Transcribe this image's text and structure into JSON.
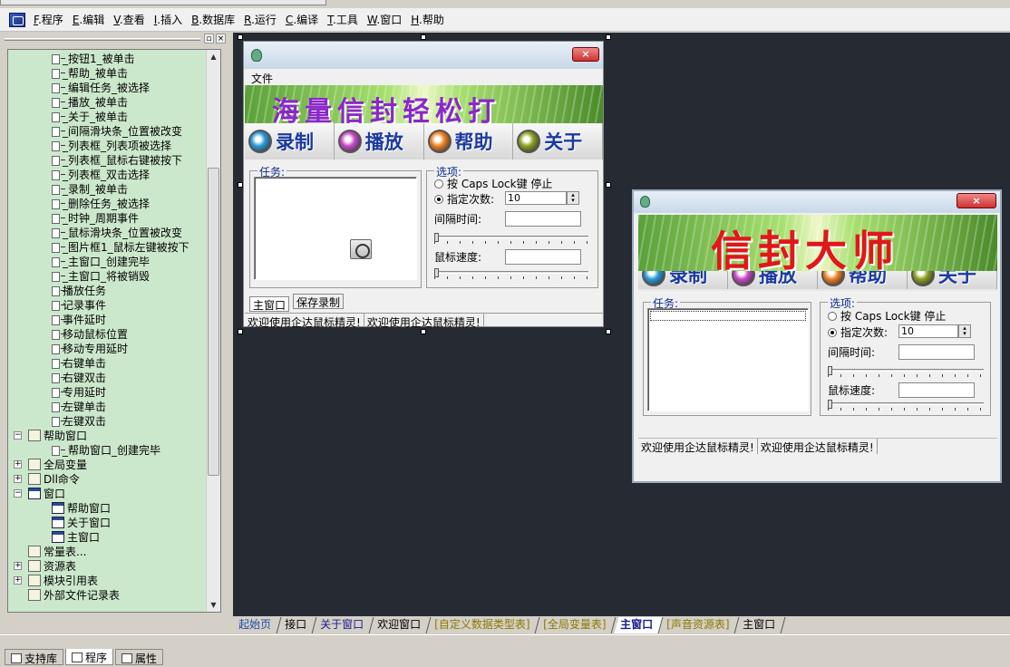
{
  "menubar": {
    "items": [
      {
        "key": "F",
        "label": ".程序"
      },
      {
        "key": "E",
        "label": ".编辑"
      },
      {
        "key": "V",
        "label": ".查看"
      },
      {
        "key": "I",
        "label": ".插入"
      },
      {
        "key": "B",
        "label": ".数据库"
      },
      {
        "key": "R",
        "label": ".运行"
      },
      {
        "key": "C",
        "label": ".编译"
      },
      {
        "key": "T",
        "label": ".工具"
      },
      {
        "key": "W",
        "label": ".窗口"
      },
      {
        "key": "H",
        "label": ".帮助"
      }
    ]
  },
  "left_panel": {
    "pin_label": "▫",
    "close_label": "×",
    "tree": [
      {
        "label": "_按钮1_被单击",
        "icon": "event-icon"
      },
      {
        "label": "_帮助_被单击",
        "icon": "event-icon"
      },
      {
        "label": "_编辑任务_被选择",
        "icon": "event-icon"
      },
      {
        "label": "_播放_被单击",
        "icon": "event-icon"
      },
      {
        "label": "_关于_被单击",
        "icon": "event-icon"
      },
      {
        "label": "_间隔滑块条_位置被改变",
        "icon": "event-icon"
      },
      {
        "label": "_列表框_列表项被选择",
        "icon": "event-icon"
      },
      {
        "label": "_列表框_鼠标右键被按下",
        "icon": "event-icon"
      },
      {
        "label": "_列表框_双击选择",
        "icon": "event-icon"
      },
      {
        "label": "_录制_被单击",
        "icon": "event-icon"
      },
      {
        "label": "_删除任务_被选择",
        "icon": "event-icon"
      },
      {
        "label": "_时钟_周期事件",
        "icon": "event-icon"
      },
      {
        "label": "_鼠标滑块条_位置被改变",
        "icon": "event-icon"
      },
      {
        "label": "_图片框1_鼠标左键被按下",
        "icon": "event-icon"
      },
      {
        "label": "_主窗口_创建完毕",
        "icon": "event-icon"
      },
      {
        "label": "_主窗口_将被销毁",
        "icon": "event-icon"
      },
      {
        "label": "播放任务",
        "icon": "event-icon"
      },
      {
        "label": "记录事件",
        "icon": "event-icon"
      },
      {
        "label": "事件延时",
        "icon": "event-icon"
      },
      {
        "label": "移动鼠标位置",
        "icon": "event-icon"
      },
      {
        "label": "移动专用延时",
        "icon": "event-icon"
      },
      {
        "label": "右键单击",
        "icon": "event-icon"
      },
      {
        "label": "右键双击",
        "icon": "event-icon"
      },
      {
        "label": "专用延时",
        "icon": "event-icon"
      },
      {
        "label": "左键单击",
        "icon": "event-icon"
      },
      {
        "label": "左键双击",
        "icon": "event-icon"
      },
      {
        "label": "帮助窗口",
        "icon": "assembly-icon",
        "expander": "−"
      },
      {
        "label": "_帮助窗口_创建完毕",
        "icon": "event-icon"
      },
      {
        "label": "全局变量",
        "icon": "variable-icon",
        "expander": "+"
      },
      {
        "label": "Dll命令",
        "icon": "dll-icon",
        "expander": "+"
      },
      {
        "label": "窗口",
        "icon": "window-icon",
        "expander": "−"
      },
      {
        "label": "帮助窗口",
        "icon": "window-icon"
      },
      {
        "label": "关于窗口",
        "icon": "window-icon"
      },
      {
        "label": "主窗口",
        "icon": "window-icon"
      },
      {
        "label": "常量表...",
        "icon": "constant-icon"
      },
      {
        "label": "资源表",
        "icon": "resource-icon",
        "expander": "+"
      },
      {
        "label": "模块引用表",
        "icon": "module-icon",
        "expander": "+"
      },
      {
        "label": "外部文件记录表",
        "icon": "file-icon"
      }
    ],
    "bottom_tabs": [
      {
        "label": "支持库",
        "icon": "library-icon"
      },
      {
        "label": "程序",
        "icon": "program-icon",
        "active": true
      },
      {
        "label": "属性",
        "icon": "properties-icon"
      }
    ]
  },
  "design_window": {
    "close_label": "×",
    "menu": "文件",
    "banner": "海量信封轻松打",
    "buttons": [
      "录制",
      "播放",
      "帮助",
      "关于"
    ],
    "task_label": "任务:",
    "options_label": "选项:",
    "opt1": "按 Caps Lock键 停止",
    "opt2": "指定次数:",
    "count_value": "10",
    "interval_label": "间隔时间:",
    "speed_label": "鼠标速度:",
    "subtabs": [
      "主窗口",
      "保存录制"
    ],
    "status": [
      "欢迎使用企达鼠标精灵!",
      "欢迎使用企达鼠标精灵!"
    ]
  },
  "preview_window": {
    "close_label": "×",
    "banner": "信封大师",
    "buttons": [
      "录制",
      "播放",
      "帮助",
      "关于"
    ],
    "task_label": "任务:",
    "options_label": "选项:",
    "opt1": "按 Caps Lock键 停止",
    "opt2": "指定次数:",
    "count_value": "10",
    "interval_label": "间隔时间:",
    "speed_label": "鼠标速度:",
    "status": [
      "欢迎使用企达鼠标精灵!",
      "欢迎使用企达鼠标精灵!"
    ]
  },
  "doc_tabs": [
    {
      "label": "起始页",
      "color": "#1a4fa0"
    },
    {
      "label": "接口",
      "color": "#000000"
    },
    {
      "label": "关于窗口",
      "color": "#1a1a8a"
    },
    {
      "label": "欢迎窗口",
      "color": "#000000"
    },
    {
      "label": "[自定义数据类型表]",
      "color": "#8a7a00"
    },
    {
      "label": "[全局变量表]",
      "color": "#8a7a00"
    },
    {
      "label": "主窗口",
      "color": "#1a1a8a",
      "active": true
    },
    {
      "label": "[声音资源表]",
      "color": "#8a7a00"
    },
    {
      "label": "主窗口",
      "color": "#000000"
    }
  ],
  "colors": {
    "tree_bg": "#cce8cc",
    "designer_bg": "#252a33"
  }
}
